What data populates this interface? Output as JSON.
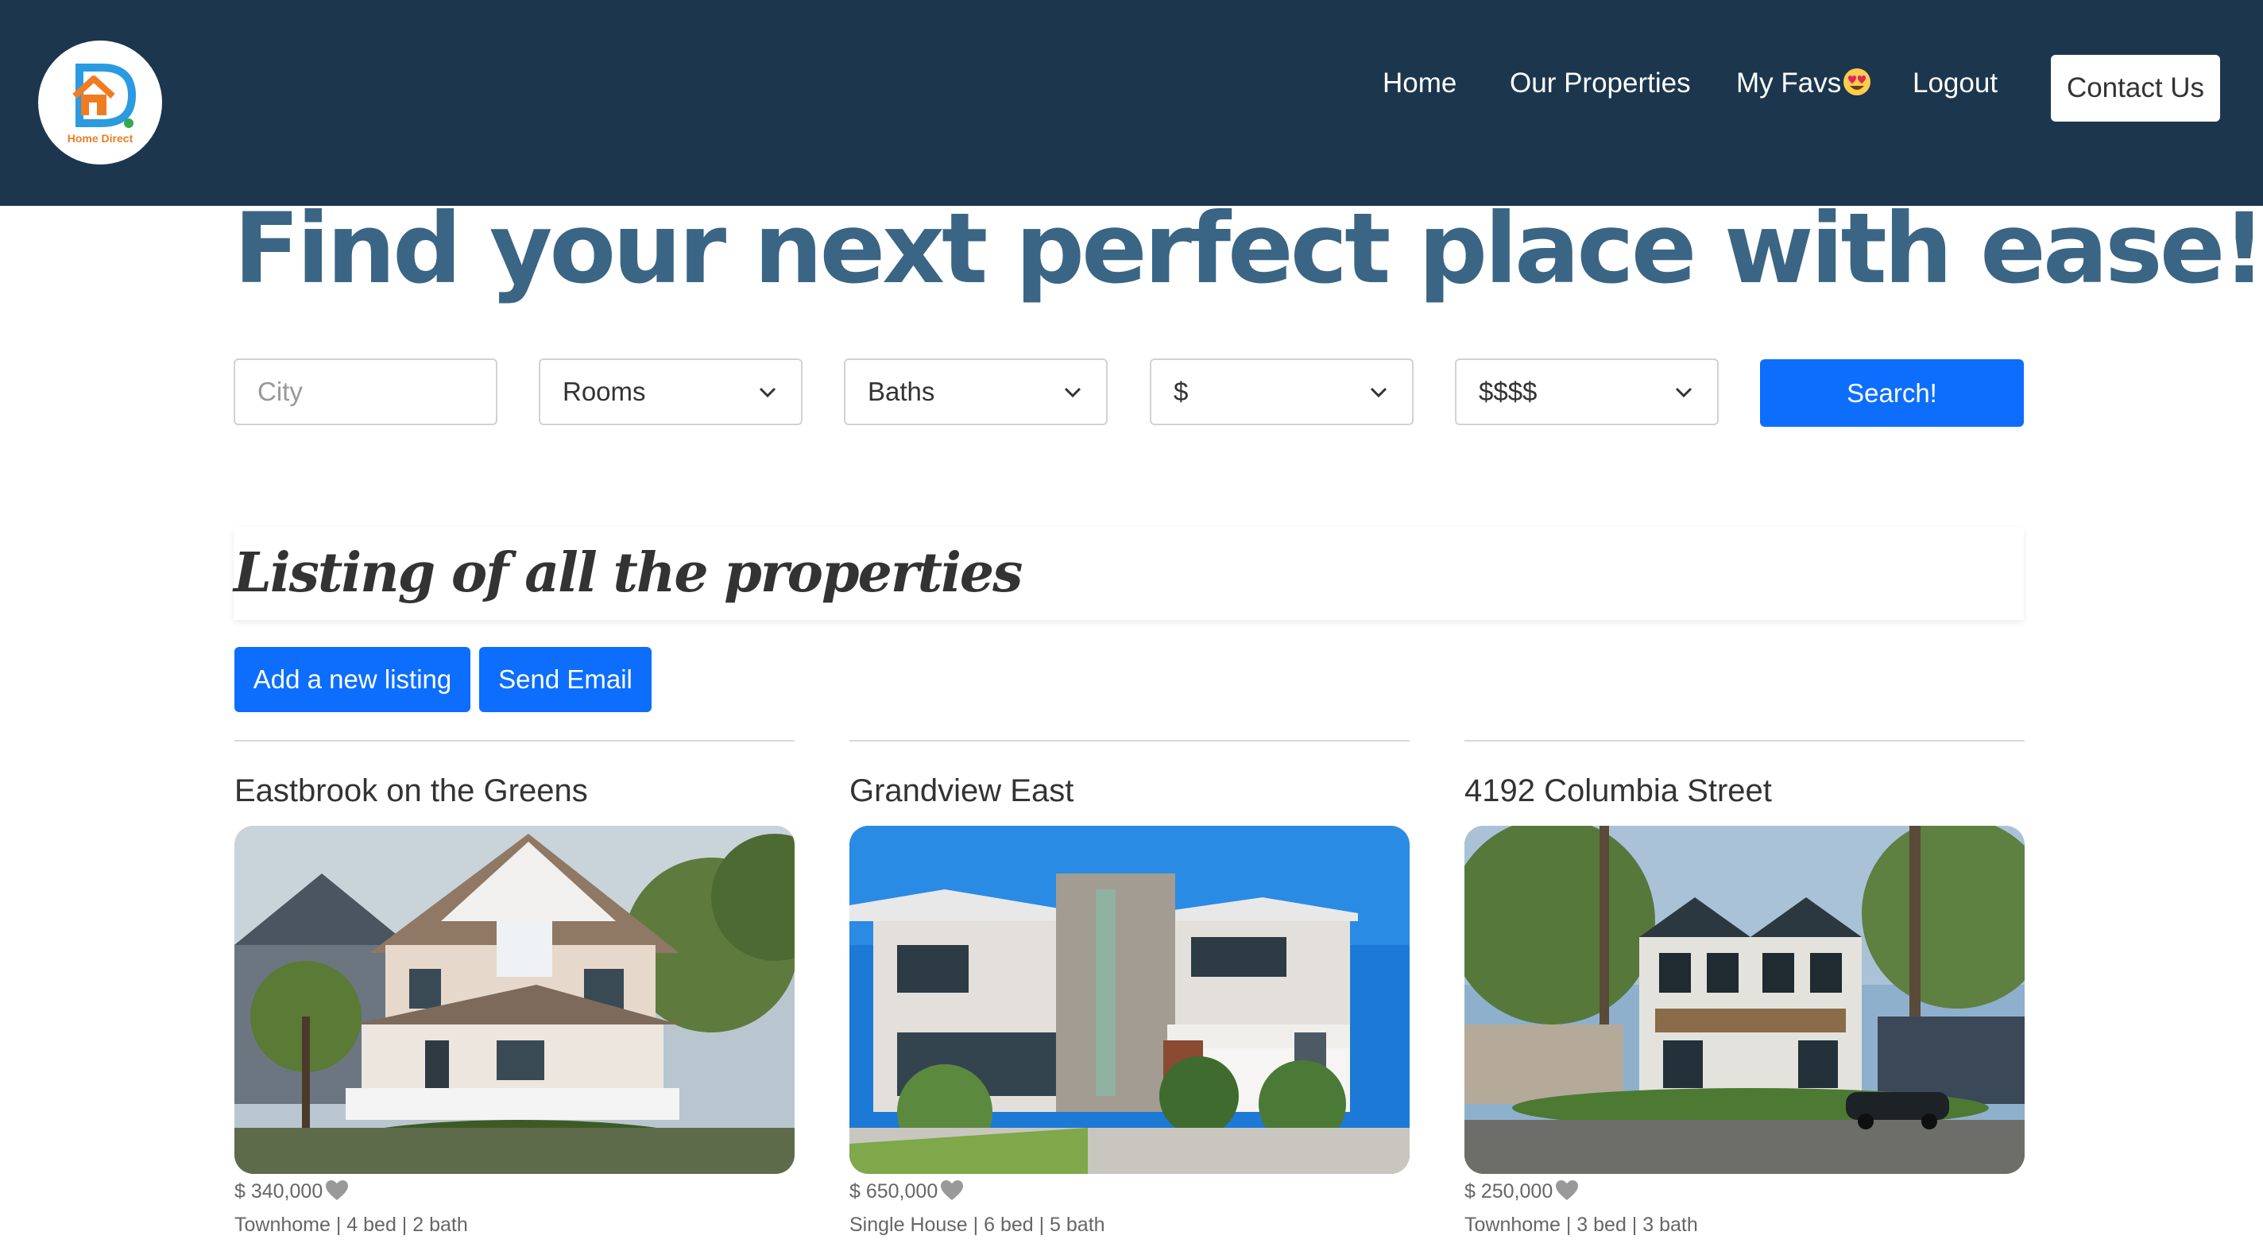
{
  "brand": {
    "logo_text": "Home Direct"
  },
  "nav": {
    "home": "Home",
    "properties": "Our Properties",
    "favs": "My Favs",
    "favs_emoji": "heart-eyes-emoji",
    "logout": "Logout",
    "contact": "Contact Us"
  },
  "hero": {
    "title": "Find your next perfect place with ease!"
  },
  "search": {
    "city_placeholder": "City",
    "rooms": "Rooms",
    "baths": "Baths",
    "min_price": "$",
    "max_price": "$$$$",
    "button": "Search!"
  },
  "listing": {
    "title": "Listing of all the properties",
    "add_button": "Add a new listing",
    "email_button": "Send Email"
  },
  "properties": [
    {
      "name": "Eastbrook on the Greens",
      "price": "$ 340,000",
      "details": "Townhome | 4 bed | 2 bath"
    },
    {
      "name": "Grandview East",
      "price": "$ 650,000",
      "details": "Single House | 6 bed | 5 bath"
    },
    {
      "name": "4192 Columbia Street",
      "price": "$ 250,000",
      "details": "Townhome | 3 bed | 3 bath"
    }
  ],
  "colors": {
    "navbar": "#1c364e",
    "hero_text": "#3b6584",
    "primary_button": "#0d6efd",
    "heart": "#999999"
  }
}
